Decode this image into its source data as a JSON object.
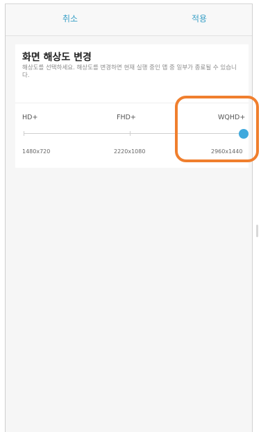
{
  "actionbar": {
    "cancel_label": "취소",
    "apply_label": "적용"
  },
  "resolution": {
    "title": "화면 해상도 변경",
    "description": "해상도를 선택하세요. 해상도를 변경하면 현재 실행 중인 앱 중 일부가 종료될 수 있습니다.",
    "options": [
      {
        "label": "HD+",
        "value": "1480x720"
      },
      {
        "label": "FHD+",
        "value": "2220x1080"
      },
      {
        "label": "WQHD+",
        "value": "2960x1440"
      }
    ],
    "selected_index": 2
  },
  "colors": {
    "accent": "#3fa9dd",
    "highlight": "#f07f2e"
  }
}
